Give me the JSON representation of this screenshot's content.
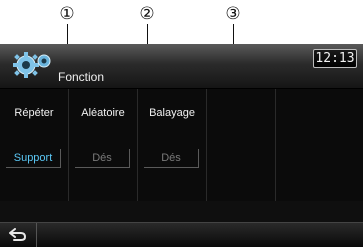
{
  "callouts": [
    "①",
    "②",
    "③"
  ],
  "titlebar": {
    "title": "Fonction",
    "icon": "gear-icon",
    "clock": "12:13"
  },
  "tiles": [
    {
      "label": "Répéter",
      "value": "Support",
      "state": "active"
    },
    {
      "label": "Aléatoire",
      "value": "Dés",
      "state": "inactive"
    },
    {
      "label": "Balayage",
      "value": "Dés",
      "state": "inactive"
    }
  ],
  "bottombar": {
    "back_icon": "back-arrow-icon"
  },
  "colors": {
    "active_value": "#5bc8f5",
    "inactive_value": "#7a7a7a",
    "background": "#0f0f0f"
  }
}
